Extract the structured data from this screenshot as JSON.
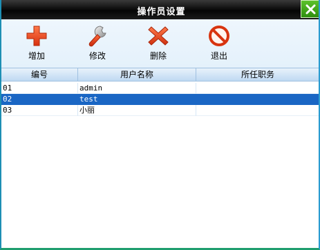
{
  "window": {
    "title": "操作员设置"
  },
  "toolbar": {
    "buttons": [
      {
        "label": "增加",
        "icon": "plus-icon",
        "color": "#e8431c"
      },
      {
        "label": "修改",
        "icon": "wrench-icon",
        "color": "#e8431c"
      },
      {
        "label": "删除",
        "icon": "delete-x-icon",
        "color": "#e8431c"
      },
      {
        "label": "退出",
        "icon": "exit-prohibited-icon",
        "color": "#e8431c"
      }
    ]
  },
  "grid": {
    "columns": [
      "编号",
      "用户名称",
      "所任职务"
    ],
    "rows": [
      {
        "id": "01",
        "name": "admin",
        "role": ""
      },
      {
        "id": "02",
        "name": "test",
        "role": "",
        "selected": true
      },
      {
        "id": "03",
        "name": "小丽",
        "role": ""
      }
    ],
    "selection_color": "#1a66c4"
  }
}
